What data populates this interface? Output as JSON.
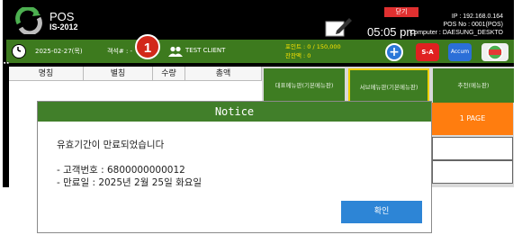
{
  "header": {
    "brand_line1": "POS",
    "brand_line2": "IS-2012",
    "clock": "05:05 pm",
    "close_label": "닫기",
    "ip": "IP : 192.168.0.164",
    "pos_no": "POS No : 0001(POS)",
    "computer": "Computer : DAESUNG_DESKTO"
  },
  "infobar": {
    "date": "2025-02-27(목)",
    "guest_label": "객석# : -",
    "callout_number": "1",
    "client": "TEST CLIENT",
    "points": "포인트 : 0 / 150,000",
    "balance": "잔잔액 : 0",
    "sa_label": "S-A",
    "accum_label": "Accum"
  },
  "table": {
    "columns": [
      "명칭",
      "별칭",
      "수량",
      "총액"
    ]
  },
  "tabs": [
    {
      "label": "대표메뉴판(기본메뉴판)",
      "selected": false
    },
    {
      "label": "서브메뉴판(기본메뉴판)",
      "selected": true
    },
    {
      "label": "추천(메뉴판)",
      "selected": false
    }
  ],
  "page_button": "1 PAGE",
  "modal": {
    "title": "Notice",
    "message": "유효기간이 만료되었습니다",
    "line1": "- 고객번호 : 6800000000012",
    "line2": "- 만료일 : 2025년 2월 25일 화요일",
    "ok_label": "확인"
  },
  "colors": {
    "header_bg": "#000000",
    "green_bar": "#3d7a1e",
    "modal_header": "#417f2a",
    "ok_button": "#2d85d6",
    "page_button": "#ff7d0f",
    "callout_badge": "#d2281a"
  }
}
